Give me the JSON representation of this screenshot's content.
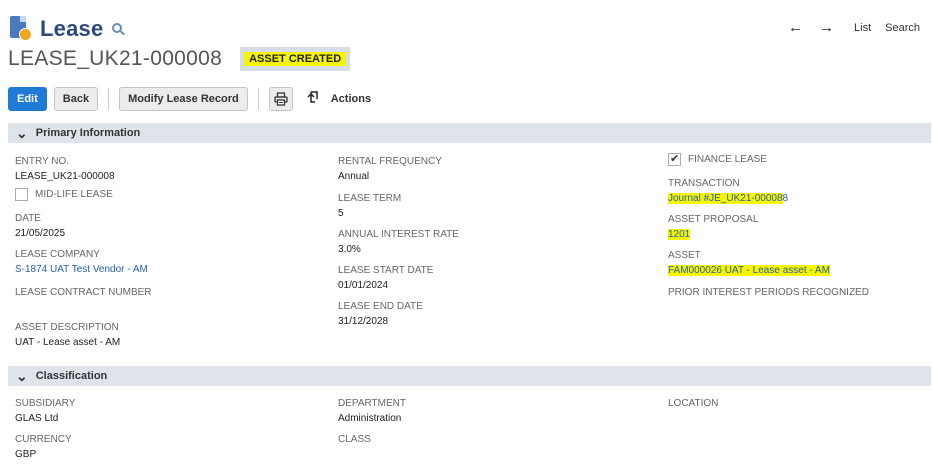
{
  "header": {
    "record_type": "Lease",
    "record_name": "LEASE_UK21-000008",
    "status": "ASSET CREATED",
    "nav": {
      "back_arrow": "←",
      "forward_arrow": "→",
      "list": "List",
      "search": "Search"
    }
  },
  "toolbar": {
    "edit": "Edit",
    "back": "Back",
    "modify": "Modify Lease Record",
    "print_icon": "printer-icon",
    "actions_icon": "actions-icon",
    "actions": "Actions"
  },
  "sections": {
    "primary": "Primary Information",
    "classification": "Classification"
  },
  "primary": {
    "entry_no_label": "ENTRY NO.",
    "entry_no": "LEASE_UK21-000008",
    "mid_life_label": "MID-LIFE LEASE",
    "mid_life_checked": false,
    "date_label": "DATE",
    "date": "21/05/2025",
    "company_label": "LEASE COMPANY",
    "company": "S-1874 UAT Test Vendor - AM",
    "contract_label": "LEASE CONTRACT NUMBER",
    "contract": "",
    "asset_desc_label": "ASSET DESCRIPTION",
    "asset_desc": "UAT - Lease asset - AM",
    "rental_freq_label": "RENTAL FREQUENCY",
    "rental_freq": "Annual",
    "term_label": "LEASE TERM",
    "term": "5",
    "rate_label": "ANNUAL INTEREST RATE",
    "rate": "3.0%",
    "start_label": "LEASE START DATE",
    "start": "01/01/2024",
    "end_label": "LEASE END DATE",
    "end": "31/12/2028",
    "finance_lease_label": "FINANCE LEASE",
    "finance_lease_checked": true,
    "transaction_label": "TRANSACTION",
    "transaction_highlighted": "Journal #JE_UK21-00008",
    "transaction_tail": "8",
    "proposal_label": "ASSET PROPOSAL",
    "proposal": "1201",
    "asset_label": "ASSET",
    "asset": "FAM000026 UAT - Lease asset - AM",
    "prior_label": "PRIOR INTEREST PERIODS RECOGNIZED",
    "prior": ""
  },
  "classification": {
    "subsidiary_label": "SUBSIDIARY",
    "subsidiary": "GLAS Ltd",
    "currency_label": "CURRENCY",
    "currency": "GBP",
    "department_label": "DEPARTMENT",
    "department": "Administration",
    "class_label": "CLASS",
    "class": "",
    "location_label": "LOCATION",
    "location": ""
  },
  "colors": {
    "primary_button": "#1f7bd6",
    "highlight": "#f5f500",
    "link": "#2a5db0",
    "section_bar": "#dfe4eb"
  }
}
